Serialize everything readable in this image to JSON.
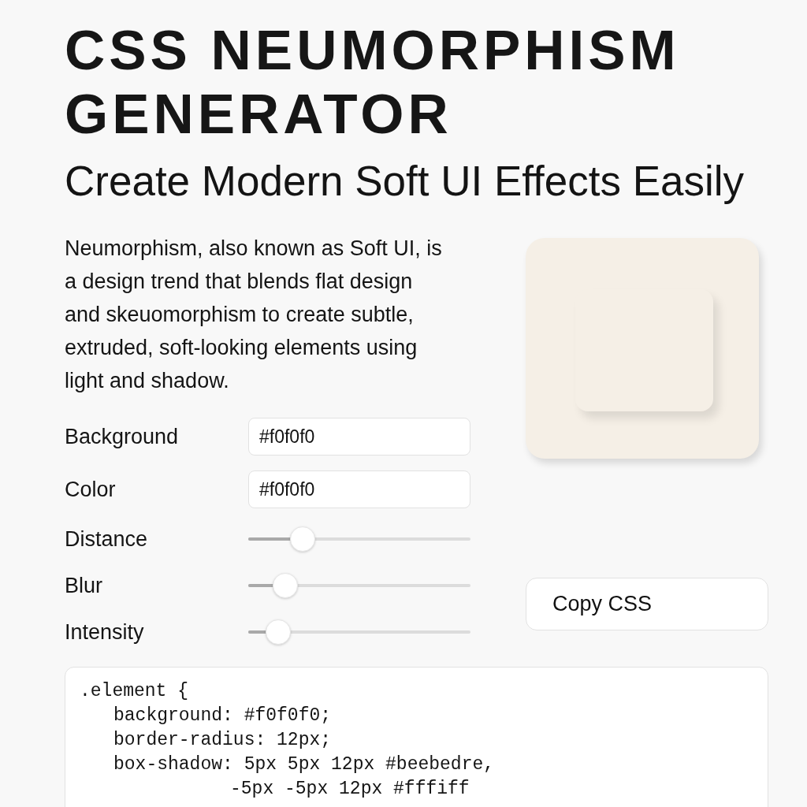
{
  "title": "CSS NEUMORPHISM GENERATOR",
  "subtitle": "Create Modern Soft UI Effects Easily",
  "description": "Neumorphism, also known as Soft UI, is a design trend that blends flat design and skeuomorphism to create subtle, extruded, soft-looking elements using light and shadow.",
  "controls": [
    {
      "kind": "text",
      "label": "Background",
      "value": "#f0f0f0"
    },
    {
      "kind": "text",
      "label": "Color",
      "value": "#f0f0f0"
    },
    {
      "kind": "slider",
      "label": "Distance",
      "level": 0.245
    },
    {
      "kind": "slider",
      "label": "Blur",
      "level": 0.167
    },
    {
      "kind": "slider",
      "label": "Intensity",
      "level": 0.135
    }
  ],
  "copy_button": {
    "label": "Copy CSS"
  },
  "code": {
    "lines": [
      {
        "kind": "selector",
        "text": ".element {"
      },
      {
        "kind": "declaration",
        "text": "background: #f0f0f0;"
      },
      {
        "kind": "declaration",
        "text": "border-radius: 12px;"
      },
      {
        "kind": "declaration",
        "text": "box-shadow: 5px 5px 12px #beebedre,"
      },
      {
        "kind": "continuation",
        "text": "-5px -5px 12px #fffiff"
      }
    ]
  }
}
